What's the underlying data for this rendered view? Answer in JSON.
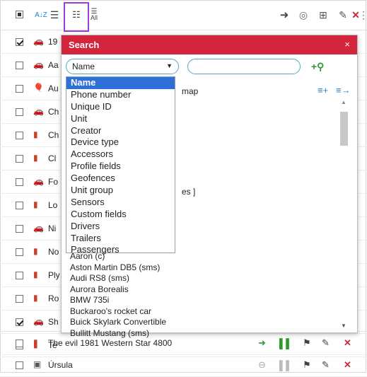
{
  "toolbar": {
    "select_all_state": "partial",
    "icons": [
      "sort-az-icon",
      "list-icon",
      "add-to-list-icon",
      "show-all-icon",
      "arrow-right-circle-icon",
      "tracking-icon",
      "export-icon",
      "wrench-icon",
      "close-icon",
      "more-icon"
    ],
    "sort_glyph": "A↓Z",
    "all_label": "All"
  },
  "units": [
    {
      "name": "19",
      "checked": true,
      "icon": "car-icon"
    },
    {
      "name": "Aa",
      "checked": false,
      "icon": "car-icon"
    },
    {
      "name": "Au",
      "checked": false,
      "icon": "balloon-icon"
    },
    {
      "name": "Ch",
      "checked": false,
      "icon": "car-icon"
    },
    {
      "name": "Ch",
      "checked": false,
      "icon": "phone-icon"
    },
    {
      "name": "Cl",
      "checked": false,
      "icon": "phone-icon"
    },
    {
      "name": "Fo",
      "checked": false,
      "icon": "car-icon"
    },
    {
      "name": "Lo",
      "checked": false,
      "icon": "phone-icon"
    },
    {
      "name": "Ni",
      "checked": false,
      "icon": "car-icon"
    },
    {
      "name": "No",
      "checked": false,
      "icon": "phone-icon"
    },
    {
      "name": "Ply",
      "checked": false,
      "icon": "phone-icon"
    },
    {
      "name": "Ro",
      "checked": false,
      "icon": "phone-icon"
    },
    {
      "name": "Sh",
      "checked": true,
      "icon": "car-icon"
    },
    {
      "name": "Te",
      "checked": false,
      "icon": "phone-icon"
    },
    {
      "name": "The evil 1981 Western Star 4800",
      "checked": false,
      "icon": "phone-icon"
    },
    {
      "name": "Úrsula",
      "checked": false,
      "icon": "person-icon"
    }
  ],
  "dialog": {
    "title": "Search",
    "close": "×",
    "criterion": "Name",
    "search_value": "",
    "map_fragment": "map",
    "hint_fragment": "es ]",
    "options": [
      "Name",
      "Phone number",
      "Unique ID",
      "Unit",
      "Creator",
      "Device type",
      "Accessors",
      "Profile fields",
      "Geofences",
      "Unit group",
      "Sensors",
      "Custom fields",
      "Drivers",
      "Trailers",
      "Passengers"
    ],
    "results": [
      "Aaron (c)",
      "Aston Martin DB5 (sms)",
      "Audi RS8 (sms)",
      "Aurora Borealis",
      "BMW 735i",
      "Buckaroo's rocket car",
      "Buick Skylark Convertible",
      "Bullitt Mustang (sms)"
    ]
  },
  "colors": {
    "accent": "#d3253c",
    "selection": "#2e6fd8",
    "highlight_frame": "#a23ad8",
    "go_green": "#2e9a2e"
  }
}
